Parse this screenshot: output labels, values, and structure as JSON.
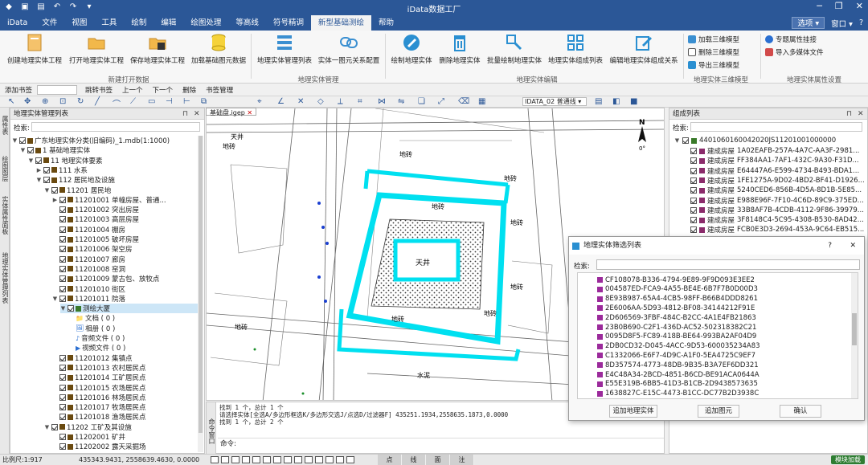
{
  "app": {
    "title": "iData数据工厂"
  },
  "menu": {
    "items": [
      "iData",
      "文件",
      "视图",
      "工具",
      "绘制",
      "编辑",
      "绘图处理",
      "等高线",
      "符号精调",
      "新型基础测绘",
      "帮助"
    ],
    "active_index": 9,
    "options_label": "选项",
    "window_label": "窗口"
  },
  "ribbon": {
    "buttons": [
      "创建地理实体工程",
      "打开地理实体工程",
      "保存地理实体工程",
      "加载基础图元数据",
      "地理实体管理列表",
      "实体一图元关系配置",
      "绘制地理实体",
      "删除地理实体",
      "批量绘制地理实体",
      "地理实体组成列表",
      "编辑地理实体组成关系"
    ],
    "small_3d": [
      "加载三维模型",
      "删除三维模型",
      "导出三维模型"
    ],
    "small_attr": [
      "专题属性挂接",
      "导入多媒体文件"
    ],
    "groups": [
      "新建打开数据",
      "地理实体管理",
      "地理实体编辑",
      "地理实体三维模型",
      "地理实体属性设置"
    ]
  },
  "bookbar": {
    "add_bookmark": "添加书签",
    "jump_bookmark": "跳转书签",
    "prev": "上一个",
    "next": "下一个",
    "delete": "删除",
    "manage": "书签管理",
    "layer_combo": "IDATA_02",
    "line_combo": "普通线"
  },
  "left_panel": {
    "title": "地理实体管理列表",
    "search_label": "检索:",
    "vtabs": [
      "属性表",
      "绘图图层",
      "实体属性面板",
      "地理实体管理列表"
    ],
    "tree": [
      {
        "level": 0,
        "tri": "▼",
        "label": "广东地理实体分类(旧编码)_1.mdb(1:1000)",
        "icon": "db"
      },
      {
        "level": 1,
        "tri": "▼",
        "label": "1 基础地理实体",
        "icon": "sq"
      },
      {
        "level": 2,
        "tri": "▼",
        "label": "11 地理实体要素",
        "icon": "sq"
      },
      {
        "level": 3,
        "tri": "▶",
        "label": "111 水系",
        "icon": "sq"
      },
      {
        "level": 3,
        "tri": "▼",
        "label": "112 居民地及设施",
        "icon": "sq"
      },
      {
        "level": 4,
        "tri": "▼",
        "label": "11201 居民地",
        "icon": "sq"
      },
      {
        "level": 5,
        "tri": "▶",
        "label": "11201001 单幢房屋、普通...",
        "icon": "sq"
      },
      {
        "level": 5,
        "tri": "",
        "label": "11201002 突出房屋",
        "icon": "sq"
      },
      {
        "level": 5,
        "tri": "",
        "label": "11201003 高层房屋",
        "icon": "sq"
      },
      {
        "level": 5,
        "tri": "",
        "label": "11201004 棚房",
        "icon": "sq"
      },
      {
        "level": 5,
        "tri": "",
        "label": "11201005 破坏房屋",
        "icon": "sq"
      },
      {
        "level": 5,
        "tri": "",
        "label": "11201006 架空房",
        "icon": "sq"
      },
      {
        "level": 5,
        "tri": "",
        "label": "11201007 廊房",
        "icon": "sq"
      },
      {
        "level": 5,
        "tri": "",
        "label": "11201008 窑洞",
        "icon": "sq"
      },
      {
        "level": 5,
        "tri": "",
        "label": "11201009 蒙古包、放牧点",
        "icon": "sq"
      },
      {
        "level": 5,
        "tri": "",
        "label": "11201010 街区",
        "icon": "sq"
      },
      {
        "level": 5,
        "tri": "▼",
        "label": "11201011 院落",
        "icon": "sq"
      },
      {
        "level": 6,
        "tri": "▼",
        "label": "测绘大厦",
        "icon": "g",
        "selected": true
      },
      {
        "level": 7,
        "tri": "",
        "label": "文档 ( 0 )",
        "icon": "folder"
      },
      {
        "level": 7,
        "tri": "",
        "label": "相册 ( 0 )",
        "icon": "photo"
      },
      {
        "level": 7,
        "tri": "",
        "label": "音频文件 ( 0 )",
        "icon": "audio"
      },
      {
        "level": 7,
        "tri": "",
        "label": "视频文件 ( 0 )",
        "icon": "video"
      },
      {
        "level": 5,
        "tri": "",
        "label": "11201012 集镇点",
        "icon": "sq"
      },
      {
        "level": 5,
        "tri": "",
        "label": "11201013 农村居民点",
        "icon": "sq"
      },
      {
        "level": 5,
        "tri": "",
        "label": "11201014 工矿居民点",
        "icon": "sq"
      },
      {
        "level": 5,
        "tri": "",
        "label": "11201015 农场居民点",
        "icon": "sq"
      },
      {
        "level": 5,
        "tri": "",
        "label": "11201016 林场居民点",
        "icon": "sq"
      },
      {
        "level": 5,
        "tri": "",
        "label": "11201017 牧场居民点",
        "icon": "sq"
      },
      {
        "level": 5,
        "tri": "",
        "label": "11201018 渔场居民点",
        "icon": "sq"
      },
      {
        "level": 4,
        "tri": "▼",
        "label": "11202 工矿及其设施",
        "icon": "sq"
      },
      {
        "level": 5,
        "tri": "",
        "label": "11202001 矿井",
        "icon": "sq"
      },
      {
        "level": 5,
        "tri": "",
        "label": "11202002 露天采掘场",
        "icon": "sq"
      }
    ]
  },
  "map": {
    "tab_label": "基础盘.igep",
    "north_label": "N",
    "north_angle": "0°",
    "labels": [
      "天井",
      "地砖",
      "地砖",
      "地砖",
      "地砖",
      "地砖",
      "地砖",
      "地砖",
      "地砖",
      "天井",
      "水泥",
      "地砖"
    ]
  },
  "command": {
    "lines": [
      "找到 1 个，总计 1 个",
      "请选择实体[全选A/多边形框选K/多边形交选J/点选D/过滤器F] 435251.1934,2558635.1873,0.0000",
      "找到 1 个，总计 2 个"
    ],
    "prompt": "命令:",
    "side_label": "命令窗口"
  },
  "right_panel": {
    "title": "组成列表",
    "search_label": "检索:",
    "root": "4401060160042020JS11201001000000",
    "rows": [
      {
        "type": "建成房屋",
        "id": "1A02EAFB-257A-4A7C-AA3F-2981..."
      },
      {
        "type": "建成房屋",
        "id": "FF384AA1-7AF1-432C-9A30-F31D..."
      },
      {
        "type": "建成房屋",
        "id": "E64447A6-E599-4734-B493-BDA1..."
      },
      {
        "type": "建成房屋",
        "id": "1FE1275A-9D02-4BD2-BF41-D1926..."
      },
      {
        "type": "建成房屋",
        "id": "5240CED6-856B-4D5A-8D1B-5E85..."
      },
      {
        "type": "建成房屋",
        "id": "E988E96F-7F10-4C6D-89C9-375ED..."
      },
      {
        "type": "建成房屋",
        "id": "33B8AF7B-4CDB-4112-9F86-39979..."
      },
      {
        "type": "建成房屋",
        "id": "3F8148C4-5C95-4308-B530-8AD42..."
      },
      {
        "type": "建成房屋",
        "id": "FCB0E3D3-2694-453A-9C64-EB515..."
      }
    ]
  },
  "dialog": {
    "title": "地理实体筛选列表",
    "help": "?",
    "close": "✕",
    "search_label": "检索:",
    "items": [
      "CF108078-B336-4794-9E89-9F9D093E3EE2",
      "004587ED-FCA9-4A55-BE4E-6B7F7B0D00D3",
      "8E93B987-65A4-4CB5-98FF-B66B4DDD8261",
      "2E6006AA-5D93-4812-BF08-34144212F91E",
      "2D606569-3FBF-484C-B2CC-4A1E4FB21863",
      "23B0B690-C2F1-436D-AC52-502318382C21",
      "0095D8F5-FC89-418B-BE64-993BA2AF04D9",
      "2DB0CD32-D045-4ACC-9D53-600035234A83",
      "C1332066-E6F7-4D9C-A1F0-5EA4725C9EF7",
      "8D357574-4773-48DB-9B35-B3A7EF6DD321",
      "E4C48A34-2BCD-4851-B6CD-BE91ACA0644A",
      "E55E319B-6BB5-41D3-B1CB-2D9438573635",
      "1638827C-E15C-4473-B1CC-DC77B2D3938C"
    ],
    "btn_add_entity": "追加地理实体",
    "btn_add_elem": "追加图元",
    "btn_ok": "确认"
  },
  "status": {
    "scale": "比例尺:1:917",
    "coords": "435343.9431, 2558639.4630, 0.0000",
    "snap": [
      "点",
      "线",
      "面",
      "注"
    ],
    "loader": "模块加载"
  }
}
